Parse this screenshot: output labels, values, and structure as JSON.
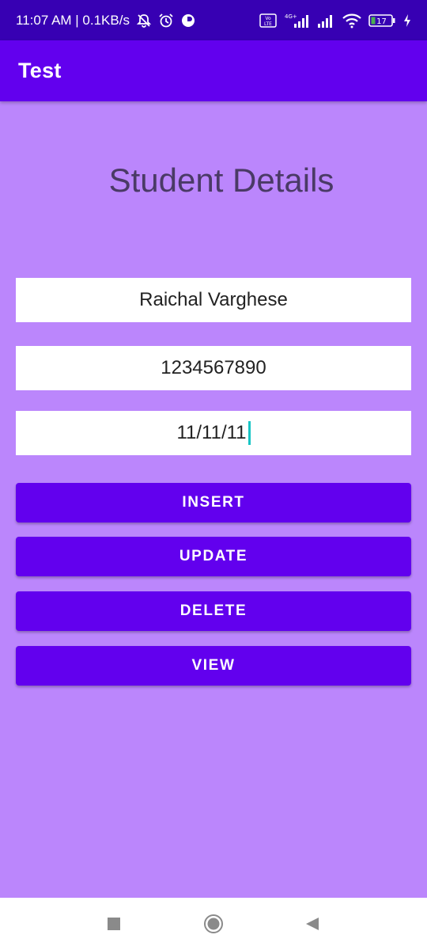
{
  "status_bar": {
    "left_text": "11:07 AM | 0.1KB/s",
    "icons": [
      "mute-icon",
      "alarm-icon",
      "app-indicator-icon"
    ],
    "right_icons": [
      "volte-icon",
      "signal-4g-icon",
      "signal-icon",
      "wifi-icon"
    ],
    "battery_level": "17",
    "battery_charging": true
  },
  "app_bar": {
    "title": "Test"
  },
  "page": {
    "heading": "Student Details",
    "fields": {
      "name": "Raichal Varghese",
      "phone": "1234567890",
      "date": "11/11/11"
    },
    "buttons": {
      "insert": "INSERT",
      "update": "UPDATE",
      "delete": "DELETE",
      "view": "VIEW"
    }
  },
  "nav_bar": {
    "icons": [
      "recents-icon",
      "home-icon",
      "back-icon"
    ]
  },
  "colors": {
    "primary": "#6200ee",
    "primary_dark": "#3700b3",
    "background": "#bb86fc",
    "heading_text": "#4a3a66",
    "caret": "#18c5c5"
  }
}
